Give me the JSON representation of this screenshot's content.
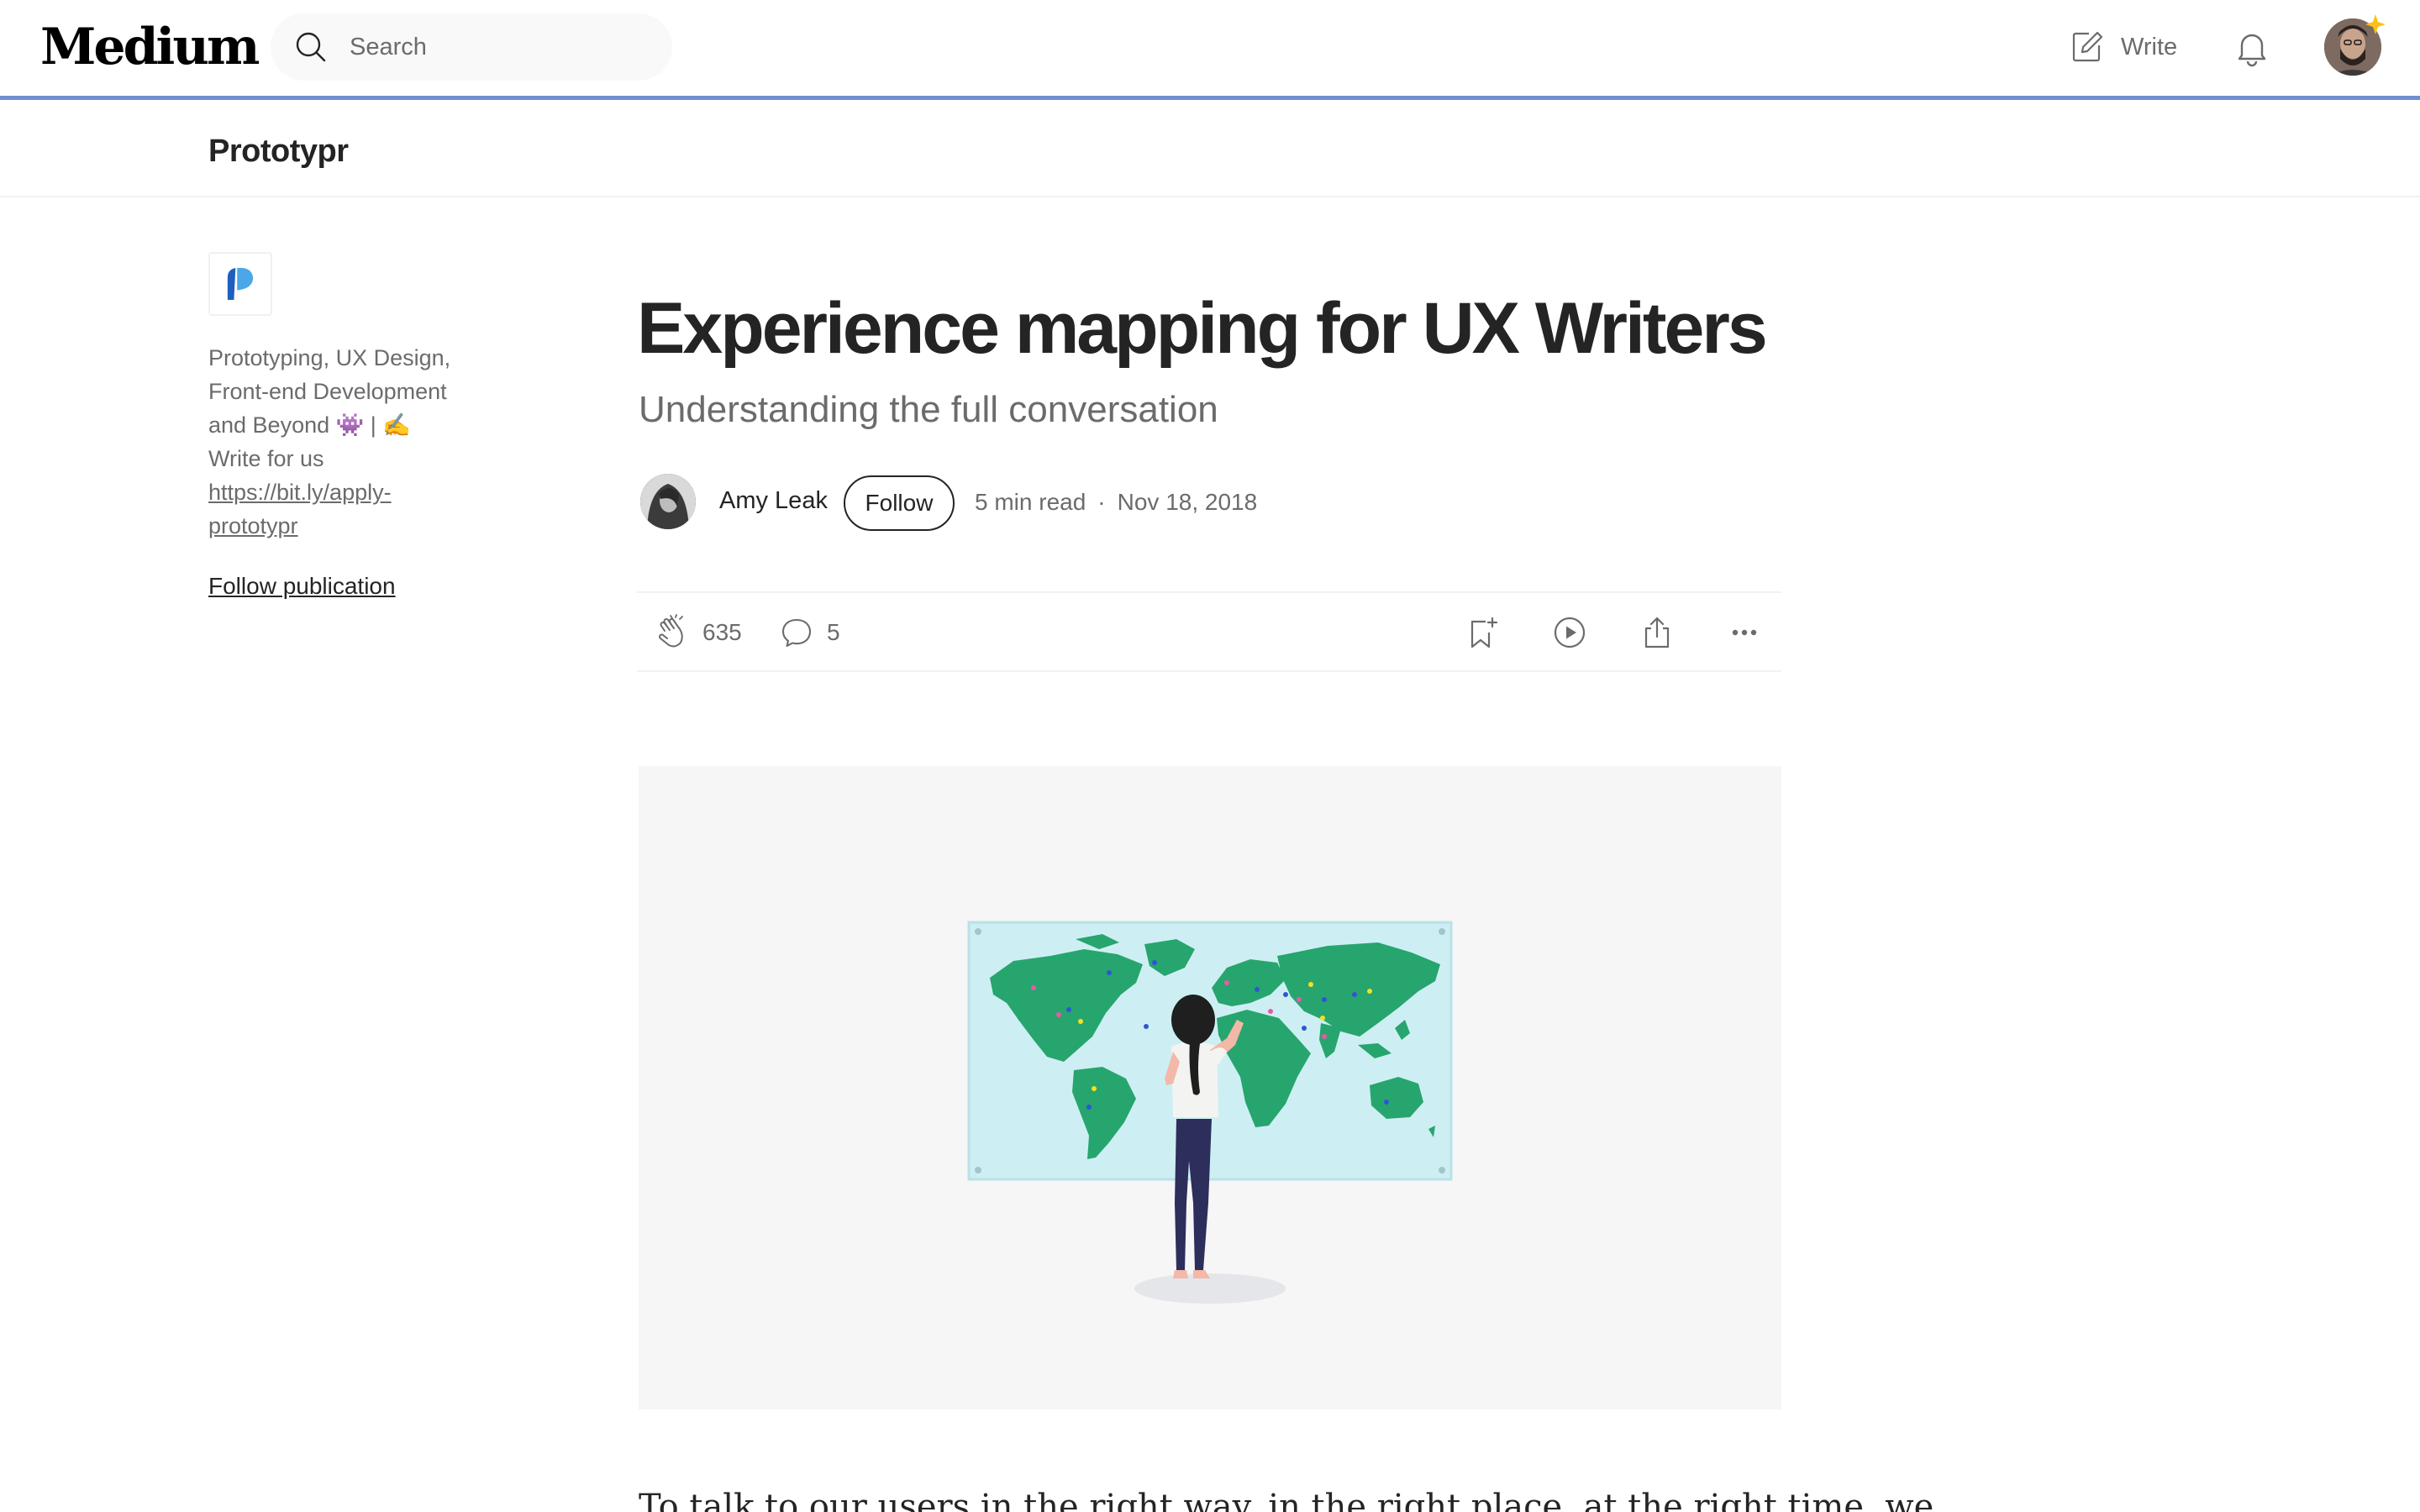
{
  "topbar": {
    "logo": "Medium",
    "search_placeholder": "Search",
    "write_label": "Write"
  },
  "publication": {
    "name": "Prototypr",
    "description_text": "Prototyping, UX Design, Front-end Development and Beyond 👾 | ✍️ Write for us ",
    "description_link": "https://bit.ly/apply-prototypr",
    "follow_label": "Follow publication"
  },
  "article": {
    "title": "Experience mapping for UX Writers",
    "subtitle": "Understanding the full conversation",
    "author": "Amy Leak",
    "follow_label": "Follow",
    "read_time": "5 min read",
    "separator": "·",
    "date": "Nov 18, 2018",
    "claps": "635",
    "responses": "5",
    "body_start": "To talk to our users in the right way, in the right place, at the right time, we"
  },
  "colors": {
    "accent_bar": "#6f8fcf",
    "text_primary": "#242424",
    "text_secondary": "#6b6b6b",
    "map_water": "#cdeff3",
    "map_land": "#27a56e"
  }
}
